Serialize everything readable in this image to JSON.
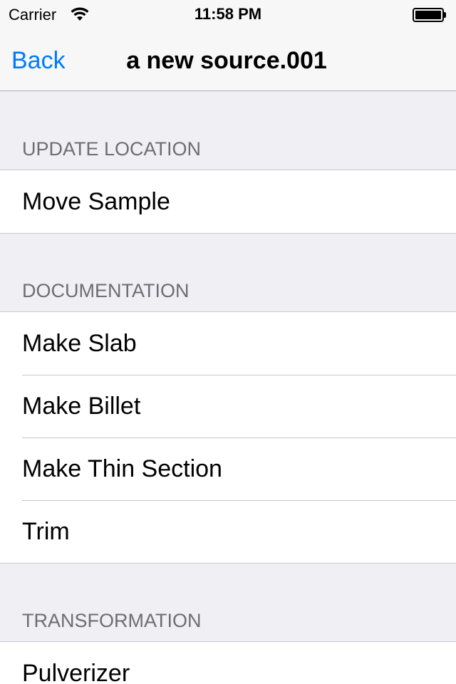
{
  "status_bar": {
    "carrier": "Carrier",
    "time": "11:58 PM",
    "wifi_icon": "wifi-icon",
    "battery_icon": "battery-icon"
  },
  "nav": {
    "back_label": "Back",
    "title": "a new source.001"
  },
  "sections": [
    {
      "header": "UPDATE LOCATION",
      "items": [
        {
          "label": "Move Sample"
        }
      ]
    },
    {
      "header": "DOCUMENTATION",
      "items": [
        {
          "label": "Make Slab"
        },
        {
          "label": "Make Billet"
        },
        {
          "label": "Make Thin Section"
        },
        {
          "label": "Trim"
        }
      ]
    },
    {
      "header": "TRANSFORMATION",
      "items": [
        {
          "label": "Pulverizer"
        }
      ]
    }
  ],
  "colors": {
    "accent": "#007aff",
    "background": "#efeff4",
    "section_header_text": "#6d6d72",
    "separator": "#c8c7cc"
  }
}
